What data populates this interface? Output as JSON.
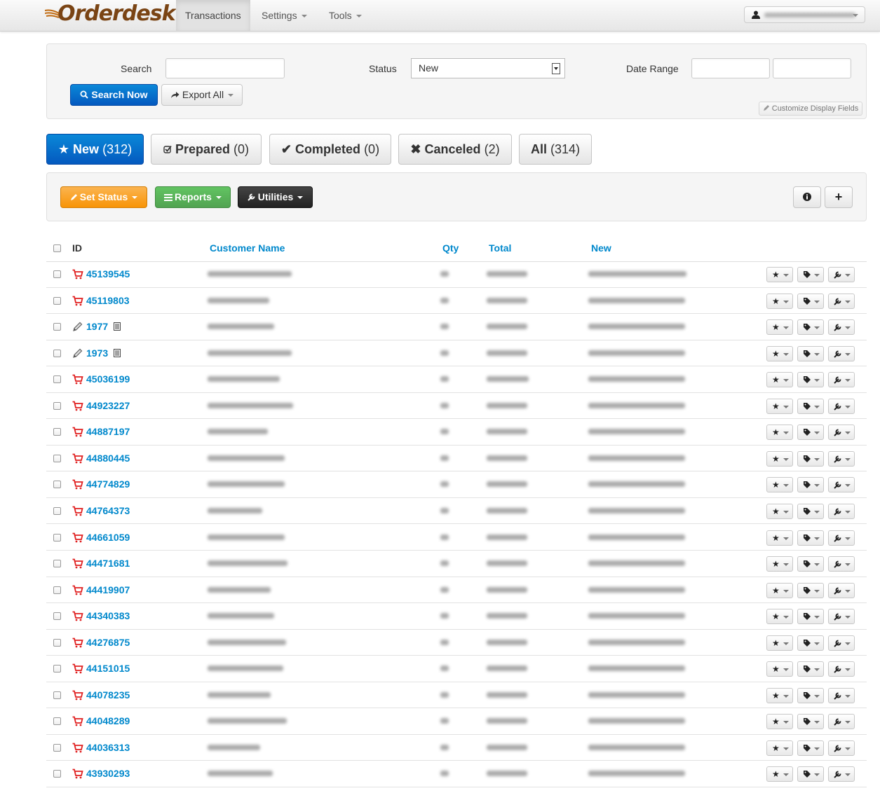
{
  "app": {
    "brand": "Orderdesk"
  },
  "nav": {
    "items": [
      {
        "label": "Transactions",
        "active": true,
        "dropdown": false
      },
      {
        "label": "Settings",
        "active": false,
        "dropdown": true
      },
      {
        "label": "Tools",
        "active": false,
        "dropdown": true
      }
    ],
    "user_icon": "user-icon"
  },
  "filters": {
    "search_label": "Search",
    "search_value": "",
    "status_label": "Status",
    "status_value": "New",
    "date_range_label": "Date Range",
    "date_from": "",
    "date_to": "",
    "search_button": "Search Now",
    "export_button": "Export All",
    "customize_button": "Customize Display Fields"
  },
  "status_tabs": [
    {
      "label": "New",
      "count": "(312)",
      "icon": "star-icon",
      "active": true
    },
    {
      "label": "Prepared",
      "count": "(0)",
      "icon": "check-square-icon",
      "active": false
    },
    {
      "label": "Completed",
      "count": "(0)",
      "icon": "check-icon",
      "active": false
    },
    {
      "label": "Canceled",
      "count": "(2)",
      "icon": "x-icon",
      "active": false
    },
    {
      "label": "All",
      "count": "(314)",
      "icon": "",
      "active": false
    }
  ],
  "actions": {
    "set_status": "Set Status",
    "reports": "Reports",
    "utilities": "Utilities",
    "info_icon": "info-icon",
    "add_icon": "plus-icon",
    "colors": {
      "orange": "#f89406",
      "green": "#51a351",
      "dark": "#222222"
    }
  },
  "table": {
    "columns": [
      "ID",
      "Customer Name",
      "Qty",
      "Total",
      "New"
    ],
    "rows": [
      {
        "id": "45139545",
        "type": "cart",
        "doc": false
      },
      {
        "id": "45119803",
        "type": "cart",
        "doc": false
      },
      {
        "id": "1977",
        "type": "pencil",
        "doc": true
      },
      {
        "id": "1973",
        "type": "pencil",
        "doc": true
      },
      {
        "id": "45036199",
        "type": "cart",
        "doc": false
      },
      {
        "id": "44923227",
        "type": "cart",
        "doc": false
      },
      {
        "id": "44887197",
        "type": "cart",
        "doc": false
      },
      {
        "id": "44880445",
        "type": "cart",
        "doc": false
      },
      {
        "id": "44774829",
        "type": "cart",
        "doc": false
      },
      {
        "id": "44764373",
        "type": "cart",
        "doc": false
      },
      {
        "id": "44661059",
        "type": "cart",
        "doc": false
      },
      {
        "id": "44471681",
        "type": "cart",
        "doc": false
      },
      {
        "id": "44419907",
        "type": "cart",
        "doc": false
      },
      {
        "id": "44340383",
        "type": "cart",
        "doc": false
      },
      {
        "id": "44276875",
        "type": "cart",
        "doc": false
      },
      {
        "id": "44151015",
        "type": "cart",
        "doc": false
      },
      {
        "id": "44078235",
        "type": "cart",
        "doc": false
      },
      {
        "id": "44048289",
        "type": "cart",
        "doc": false
      },
      {
        "id": "44036313",
        "type": "cart",
        "doc": false
      },
      {
        "id": "43930293",
        "type": "cart",
        "doc": false
      }
    ],
    "row_buttons": [
      "star-icon",
      "tag-icon",
      "wrench-icon"
    ]
  },
  "colors": {
    "link": "#0088cc",
    "primary": "#0459bf",
    "cart": "#e02020",
    "brand": "#7a4414"
  }
}
